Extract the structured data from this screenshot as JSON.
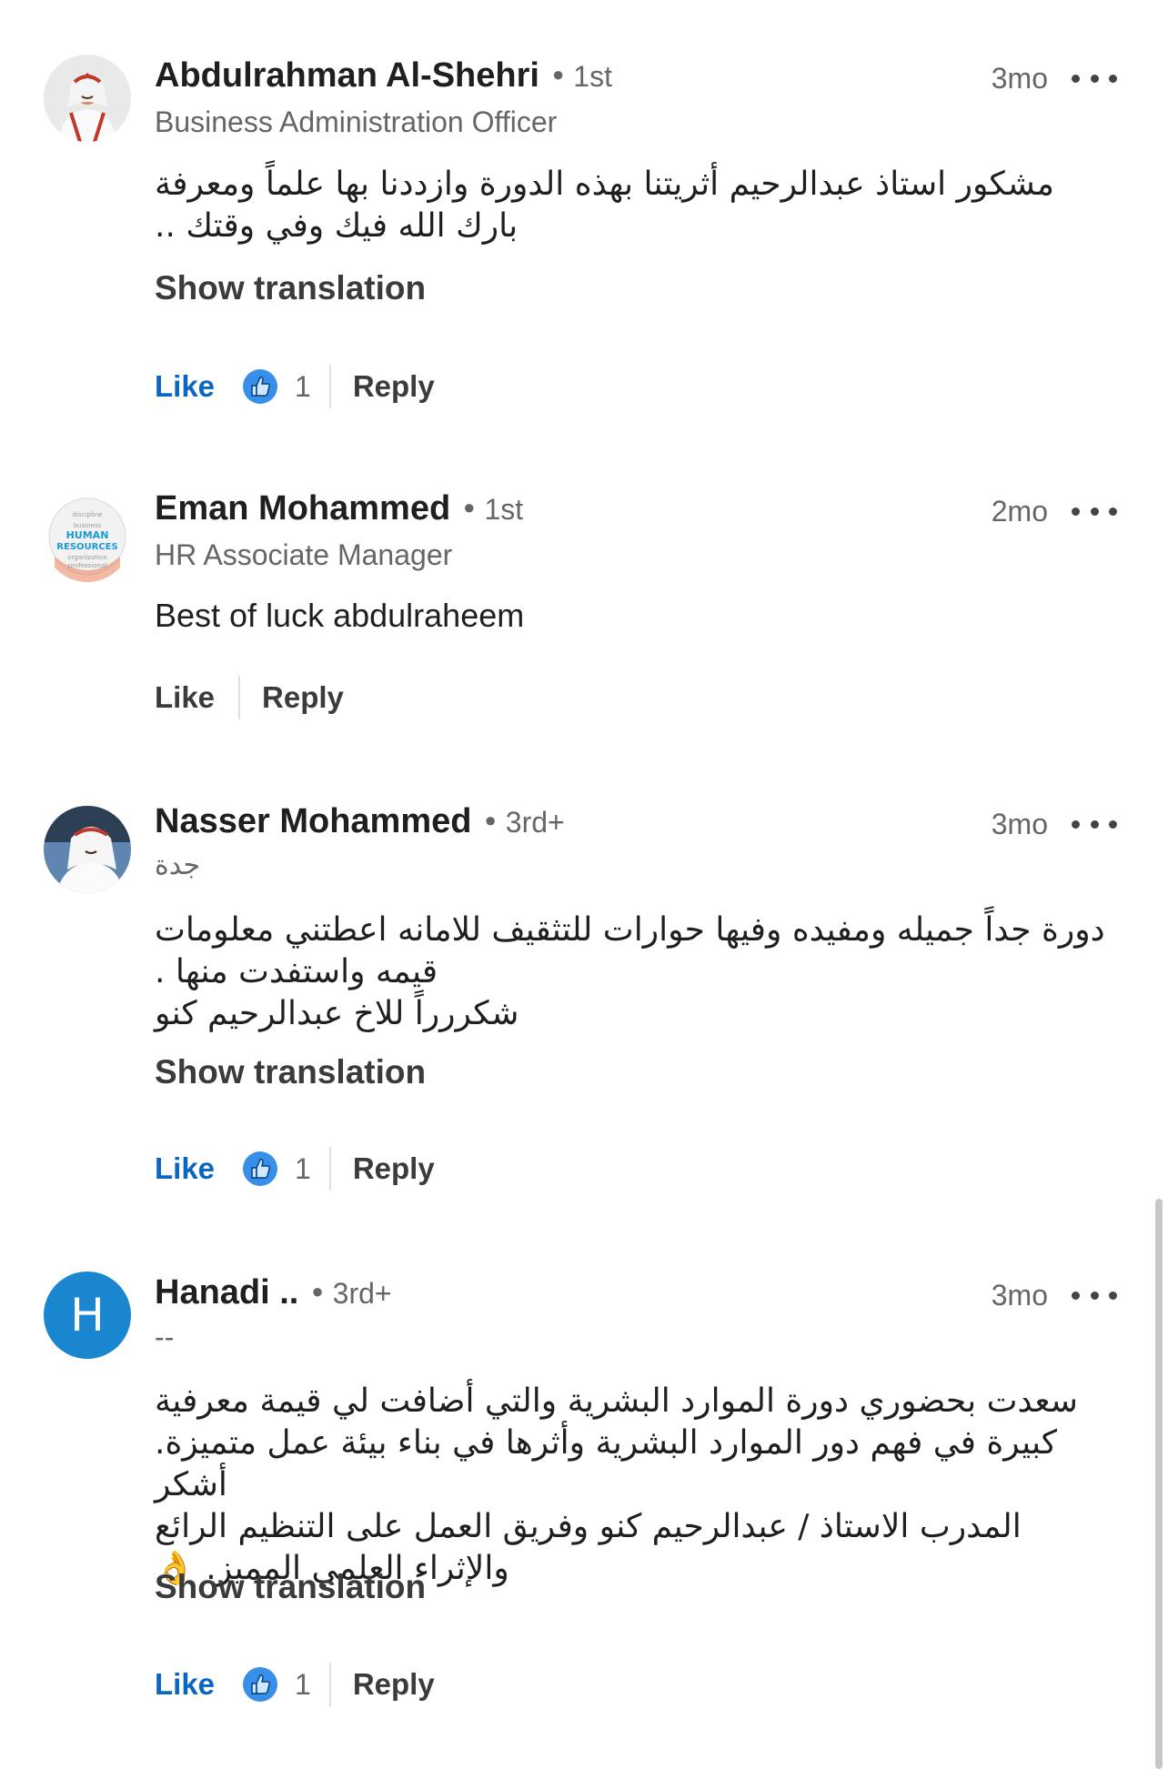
{
  "reaction_icon": "thumbs-up-reaction-icon",
  "accent_color": "#0a66c2",
  "comments": [
    {
      "author": "Abdulrahman Al-Shehri",
      "degree": "1st",
      "headline": "Business Administration Officer",
      "time": "3mo",
      "text": "مشكور استاذ عبدالرحيم أثريتنا بهذه الدورة وازددنا بها علماً ومعرفة\nبارك الله فيك وفي وقتك ..",
      "show_translation": "Show translation",
      "like_label": "Like",
      "like_count": "1",
      "reply_label": "Reply"
    },
    {
      "author": "Eman Mohammed",
      "degree": "1st",
      "headline": "HR Associate Manager",
      "time": "2mo",
      "text": "Best of luck abdulraheem",
      "like_label": "Like",
      "reply_label": "Reply"
    },
    {
      "author": "Nasser Mohammed",
      "degree": "3rd+",
      "headline": "جدة",
      "time": "3mo",
      "text": "دورة جداً جميله ومفيده وفيها حوارات للتثقيف للامانه اعطتني معلومات\nقيمه واستفدت منها .\nشكررراً للاخ عبدالرحيم كنو",
      "show_translation": "Show translation",
      "like_label": "Like",
      "like_count": "1",
      "reply_label": "Reply"
    },
    {
      "author": "Hanadi ..",
      "degree": "3rd+",
      "avatar_letter": "H",
      "headline": "--",
      "time": "3mo",
      "text": "سعدت بحضوري دورة الموارد البشرية والتي أضافت لي قيمة معرفية\nكبيرة في فهم دور الموارد البشرية وأثرها في بناء بيئة عمل متميزة. أشكر\nالمدرب الاستاذ / عبدالرحيم كنو  وفريق العمل على التنظيم الرائع\nوالإثراء العلمي المميز. 👌",
      "show_translation": "Show translation",
      "like_label": "Like",
      "like_count": "1",
      "reply_label": "Reply"
    }
  ]
}
